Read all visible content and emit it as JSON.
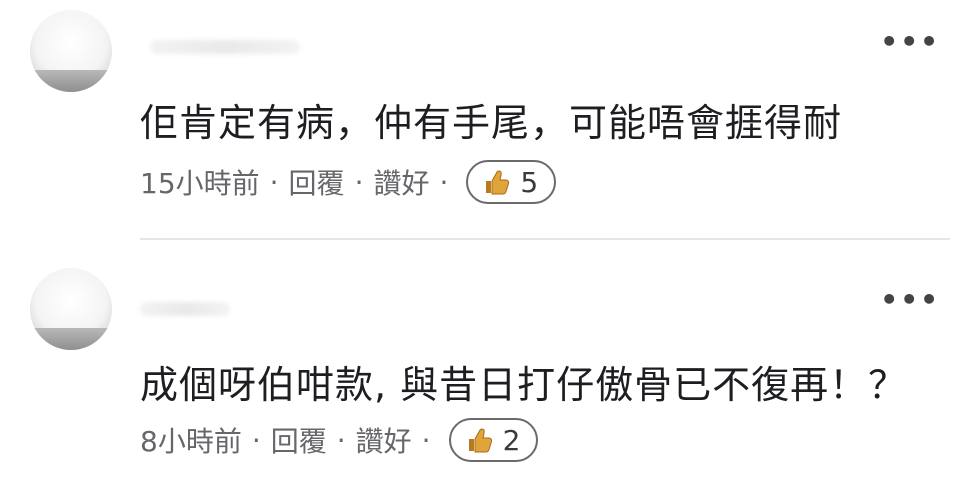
{
  "comments": [
    {
      "text": "佢肯定有病，仲有手尾，可能唔會捱得耐",
      "time": "15小時前",
      "reply_label": "回覆",
      "like_label": "讚好",
      "separator": "·",
      "like_count": "5",
      "more_label": "•••",
      "reaction_icon": "thumbs-up-icon"
    },
    {
      "text": "成個呀伯咁款, 與昔日打仔傲骨已不復再！？",
      "time": "8小時前",
      "reply_label": "回覆",
      "like_label": "讚好",
      "separator": "·",
      "like_count": "2",
      "more_label": "•••",
      "reaction_icon": "thumbs-up-icon"
    }
  ],
  "colors": {
    "text": "#1c1e21",
    "meta": "#65676b",
    "thumb": "#d99a2b",
    "divider": "#e6e6e6"
  }
}
